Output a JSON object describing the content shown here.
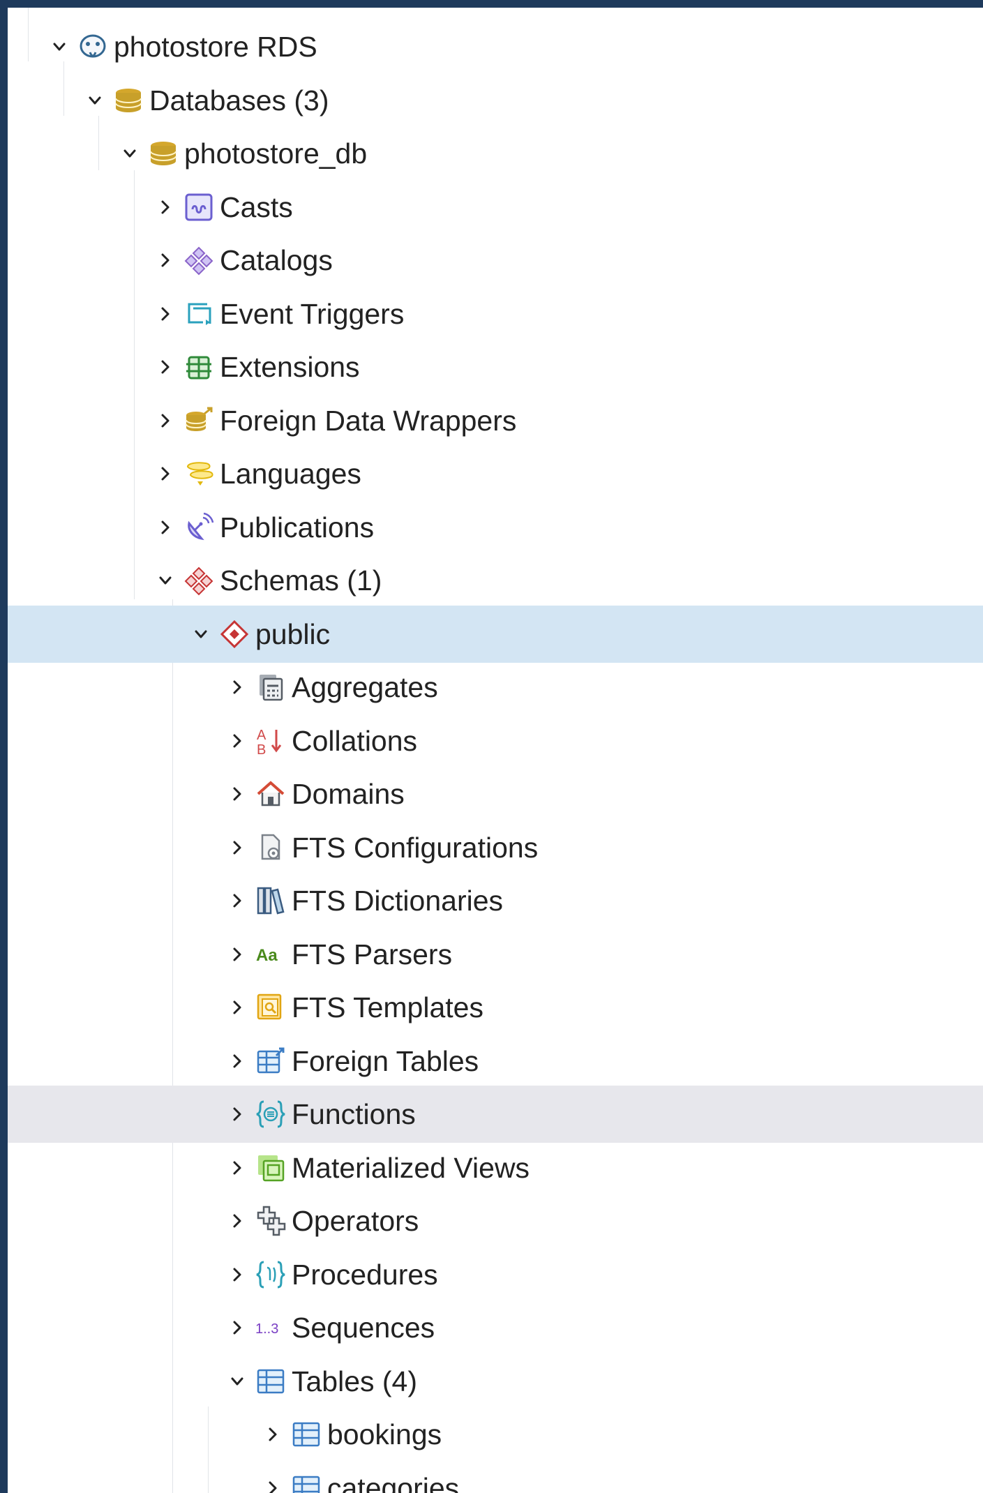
{
  "tree": {
    "server": {
      "label": "photostore RDS",
      "icon": "postgres-elephant-icon",
      "expanded": true
    },
    "databases_group": {
      "label": "Databases (3)",
      "icon": "databases-icon",
      "expanded": true
    },
    "database": {
      "label": "photostore_db",
      "icon": "database-icon",
      "expanded": true
    },
    "database_children": [
      {
        "label": "Casts",
        "icon": "casts-icon",
        "expanded": false
      },
      {
        "label": "Catalogs",
        "icon": "catalogs-icon",
        "expanded": false
      },
      {
        "label": "Event Triggers",
        "icon": "event-triggers-icon",
        "expanded": false
      },
      {
        "label": "Extensions",
        "icon": "extensions-icon",
        "expanded": false
      },
      {
        "label": "Foreign Data Wrappers",
        "icon": "foreign-data-wrappers-icon",
        "expanded": false
      },
      {
        "label": "Languages",
        "icon": "languages-icon",
        "expanded": false
      },
      {
        "label": "Publications",
        "icon": "publications-icon",
        "expanded": false
      }
    ],
    "schemas_group": {
      "label": "Schemas (1)",
      "icon": "schemas-icon",
      "expanded": true
    },
    "schema": {
      "label": "public",
      "icon": "schema-icon",
      "expanded": true,
      "selected": true
    },
    "schema_children": [
      {
        "label": "Aggregates",
        "icon": "aggregates-icon",
        "expanded": false
      },
      {
        "label": "Collations",
        "icon": "collations-icon",
        "expanded": false
      },
      {
        "label": "Domains",
        "icon": "domains-icon",
        "expanded": false
      },
      {
        "label": "FTS Configurations",
        "icon": "fts-configurations-icon",
        "expanded": false
      },
      {
        "label": "FTS Dictionaries",
        "icon": "fts-dictionaries-icon",
        "expanded": false
      },
      {
        "label": "FTS Parsers",
        "icon": "fts-parsers-icon",
        "icon_text": "Aa",
        "expanded": false
      },
      {
        "label": "FTS Templates",
        "icon": "fts-templates-icon",
        "expanded": false
      },
      {
        "label": "Foreign Tables",
        "icon": "foreign-tables-icon",
        "expanded": false
      },
      {
        "label": "Functions",
        "icon": "functions-icon",
        "expanded": false,
        "hovered": true
      },
      {
        "label": "Materialized Views",
        "icon": "materialized-views-icon",
        "expanded": false
      },
      {
        "label": "Operators",
        "icon": "operators-icon",
        "expanded": false
      },
      {
        "label": "Procedures",
        "icon": "procedures-icon",
        "expanded": false
      },
      {
        "label": "Sequences",
        "icon": "sequences-icon",
        "icon_text": "1..3",
        "expanded": false
      },
      {
        "label": "Tables (4)",
        "icon": "tables-icon",
        "expanded": true
      }
    ],
    "tables": [
      {
        "label": "bookings",
        "icon": "table-icon",
        "expanded": false
      },
      {
        "label": "categories",
        "icon": "table-icon",
        "expanded": false
      }
    ]
  },
  "colors": {
    "frame_background": "#1e3a5c",
    "panel_background": "#ffffff",
    "selected_row": "#d3e5f3",
    "hovered_row": "#e7e7ec",
    "label_text": "#222222",
    "guide_line": "#e1e4e8"
  }
}
